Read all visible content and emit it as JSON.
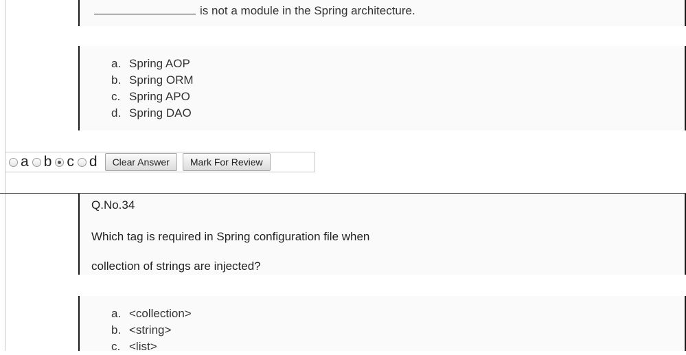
{
  "question1": {
    "blank": "_____________",
    "statement": "is not a module in the Spring architecture.",
    "options": [
      {
        "letter": "a.",
        "text": "Spring AOP"
      },
      {
        "letter": "b.",
        "text": "Spring ORM"
      },
      {
        "letter": "c.",
        "text": "Spring APO"
      },
      {
        "letter": "d.",
        "text": "Spring DAO"
      }
    ]
  },
  "answer_bar": {
    "choices": [
      "a",
      "b",
      "c",
      "d"
    ],
    "selected": "c",
    "clear_label": "Clear Answer",
    "review_label": "Mark For Review"
  },
  "question2": {
    "number": "Q.No.34",
    "line1": "Which tag is required in Spring configuration file when",
    "line2": "collection of strings are injected?",
    "options": [
      {
        "letter": "a.",
        "text": "<collection>"
      },
      {
        "letter": "b.",
        "text": "<string>"
      },
      {
        "letter": "c.",
        "text": "<list>"
      }
    ]
  }
}
